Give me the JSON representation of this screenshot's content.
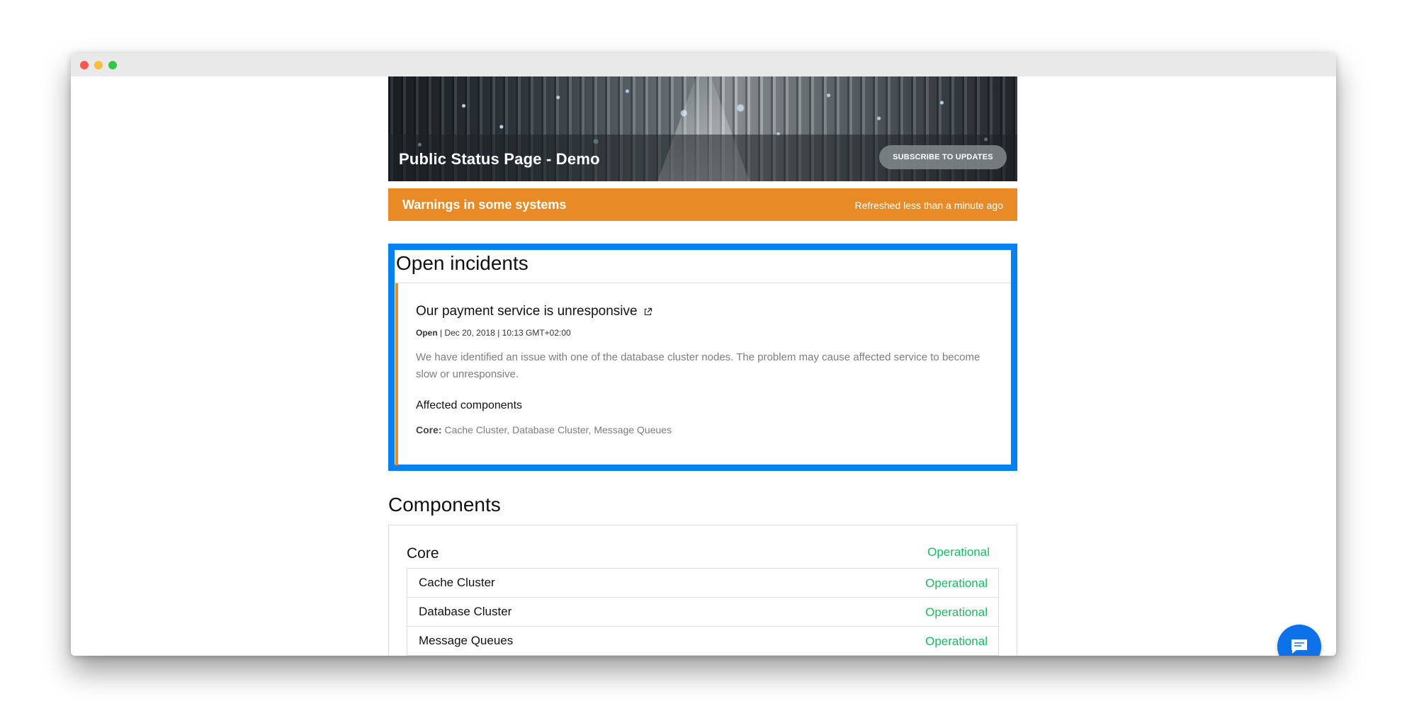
{
  "window": {
    "controls": [
      "close",
      "minimize",
      "maximize"
    ]
  },
  "hero": {
    "title": "Public Status Page - Demo",
    "subscribe_label": "SUBSCRIBE TO UPDATES"
  },
  "banner": {
    "message": "Warnings in some systems",
    "refreshed": "Refreshed less than a minute ago",
    "color": "#e88a25"
  },
  "incidents": {
    "heading": "Open incidents",
    "items": [
      {
        "title": "Our payment service is unresponsive",
        "link_icon": "external-link-icon",
        "status": "Open",
        "separator": " | ",
        "date": "Dec 20, 2018 | 10:13 GMT+02:00",
        "description": "We have identified an issue with one of the database cluster nodes. The problem may cause affected service to become slow or unresponsive.",
        "affected_heading": "Affected components",
        "affected_group": "Core:",
        "affected_components": " Cache Cluster, Database Cluster, Message Queues"
      }
    ],
    "highlight_color": "#0582f0"
  },
  "components": {
    "heading": "Components",
    "groups": [
      {
        "name": "Core",
        "status": "Operational",
        "items": [
          {
            "name": "Cache Cluster",
            "status": "Operational"
          },
          {
            "name": "Database Cluster",
            "status": "Operational"
          },
          {
            "name": "Message Queues",
            "status": "Operational"
          }
        ]
      }
    ],
    "operational_color": "#19b95f"
  },
  "chat": {
    "icon": "chat-bubble-icon",
    "color": "#0d72ea"
  }
}
